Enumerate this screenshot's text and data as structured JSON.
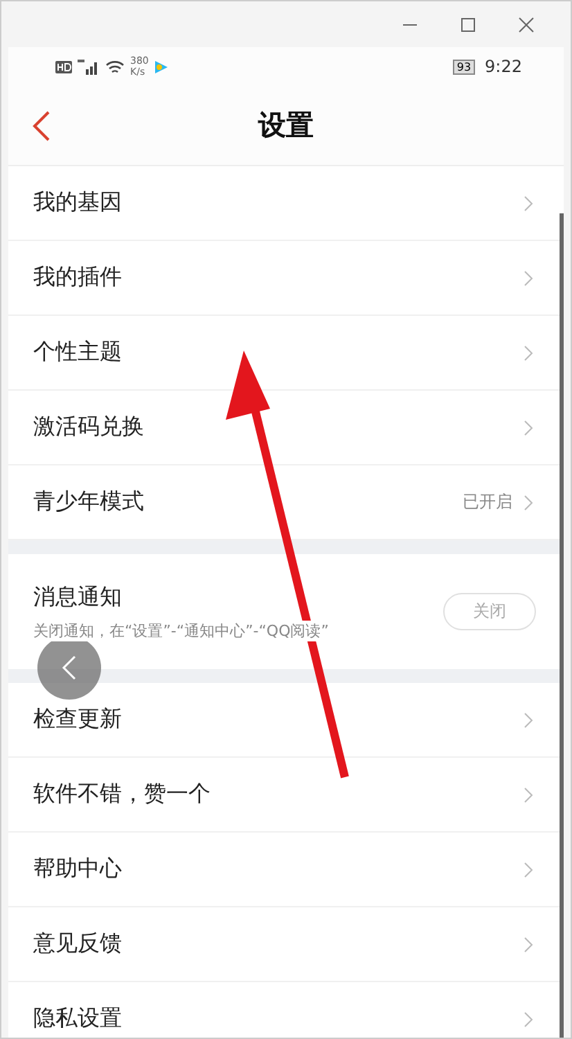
{
  "status_bar": {
    "speed": "380\nK/s",
    "battery": "93",
    "time": "9:22"
  },
  "header": {
    "title": "设置"
  },
  "group_1": [
    {
      "label": "我的基因"
    },
    {
      "label": "我的插件"
    },
    {
      "label": "个性主题"
    },
    {
      "label": "激活码兑换"
    },
    {
      "label": "青少年模式",
      "value": "已开启"
    }
  ],
  "notification": {
    "label": "消息通知",
    "hint": "关闭通知，在“设置”-“通知中心”-“QQ阅读”",
    "toggle": "关闭",
    "on": false
  },
  "group_2": [
    {
      "label": "检查更新"
    },
    {
      "label": "软件不错，赞一个"
    },
    {
      "label": "帮助中心"
    },
    {
      "label": "意见反馈"
    },
    {
      "label": "隐私设置"
    }
  ]
}
